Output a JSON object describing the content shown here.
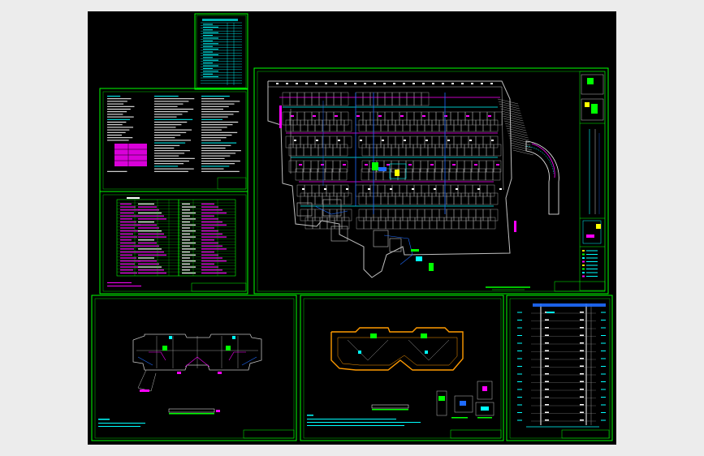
{
  "viewer": {
    "background": "#ececec",
    "canvas_background": "#000000"
  },
  "colors": {
    "frame": "#00ff00",
    "wall": "#bfbfbf",
    "cyan": "#00ffff",
    "blue": "#1e6bff",
    "magenta": "#ff00ff",
    "yellow": "#ffff00",
    "orange": "#ff9a00",
    "white": "#ffffff",
    "red": "#ff2a2a"
  },
  "sheets": [
    {
      "id": "index-table",
      "kind": "drawing index table"
    },
    {
      "id": "design-notes",
      "kind": "design notes text sheet"
    },
    {
      "id": "equipment-schedule",
      "kind": "equipment / material schedule"
    },
    {
      "id": "basement-plan",
      "kind": "basement parking electrical plan"
    },
    {
      "id": "typical-floor-plan",
      "kind": "typical floor plan"
    },
    {
      "id": "roof-plan",
      "kind": "roof plan with details"
    },
    {
      "id": "riser-diagram",
      "kind": "system riser diagram"
    }
  ]
}
